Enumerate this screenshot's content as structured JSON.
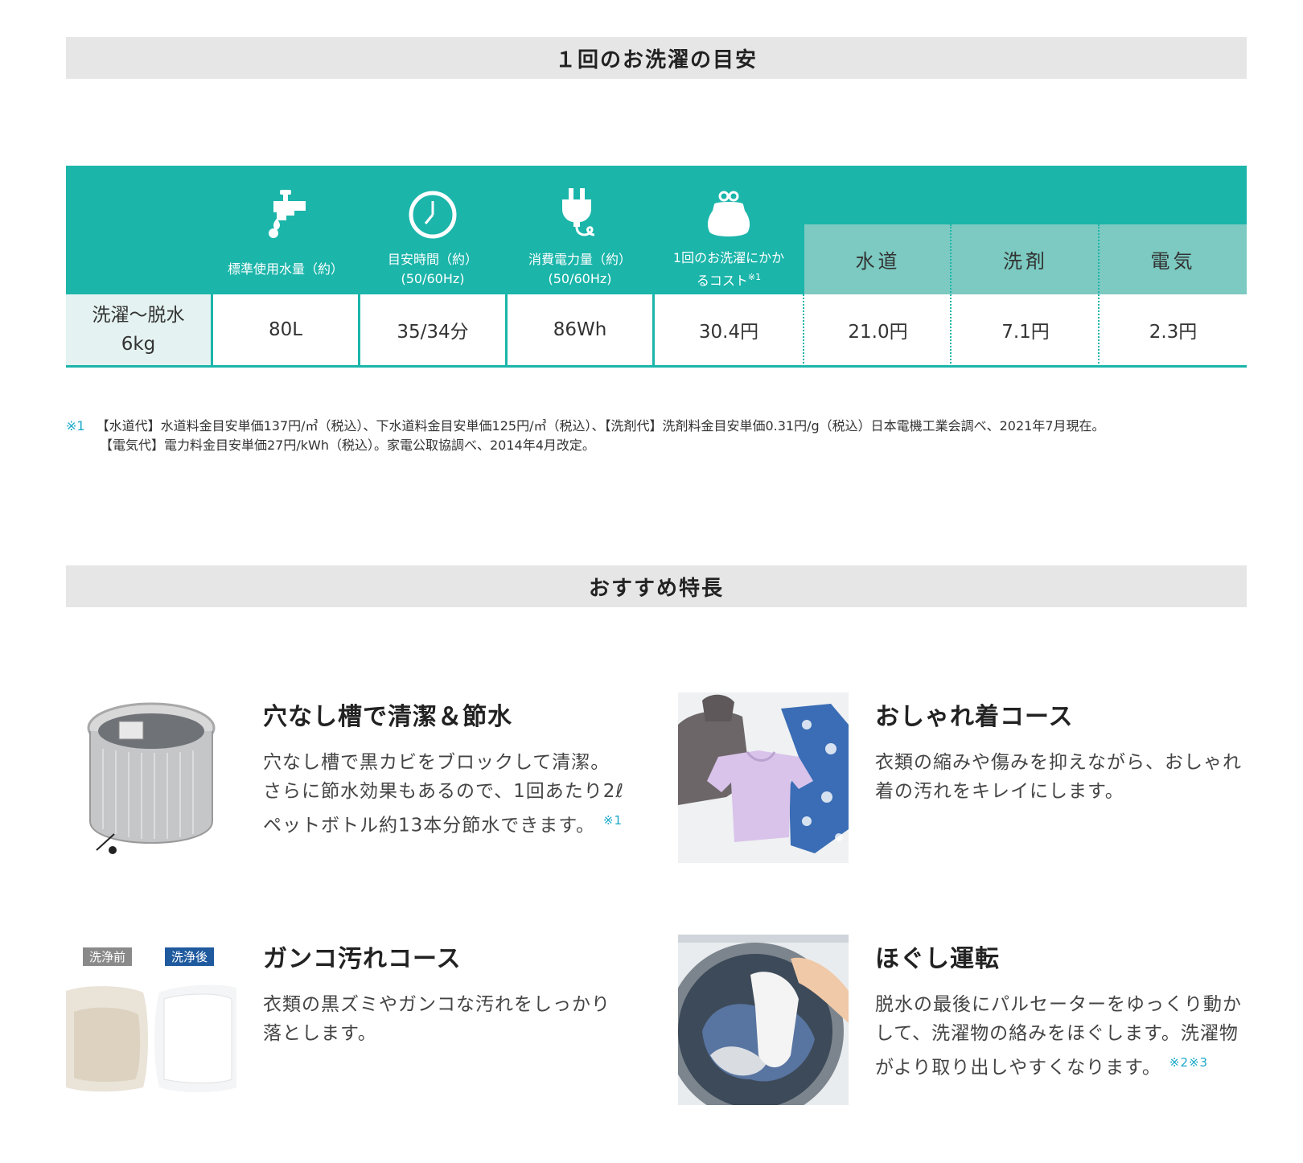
{
  "sections": {
    "guide_title": "１回のお洗濯の目安",
    "features_title": "おすすめ特長"
  },
  "table": {
    "headers": {
      "water": "標準使用水量（約）",
      "time_line1": "目安時間（約）",
      "time_line2": "(50/60Hz)",
      "power_line1": "消費電力量（約）",
      "power_line2": "(50/60Hz)",
      "cost_line1": "1回のお洗濯にかか",
      "cost_line2": "るコスト",
      "cost_note": "※1",
      "sub_water": "水道",
      "sub_detergent": "洗剤",
      "sub_electric": "電気"
    },
    "row_label_line1": "洗濯〜脱水",
    "row_label_line2": "6kg",
    "values": {
      "water": "80L",
      "time": "35/34分",
      "power": "86Wh",
      "cost": "30.4円",
      "water_cost": "21.0円",
      "detergent_cost": "7.1円",
      "electric_cost": "2.3円"
    }
  },
  "footnote": {
    "mark": "※1",
    "line1": "【水道代】水道料金目安単価137円/㎥（税込）、下水道料金目安単価125円/㎥（税込）、【洗剤代】洗剤料金目安単価0.31円/g（税込）日本電機工業会調べ、2021年7月現在。",
    "line2": "【電気代】電力料金目安単価27円/kWh（税込）。家電公取協調べ、2014年4月改定。"
  },
  "features": [
    {
      "title": "穴なし槽で清潔＆節水",
      "body": "穴なし槽で黒カビをブロックして清潔。さらに節水効果もあるので、1回あたり2ℓペットボトル約13本分節水できます。",
      "ref": "※1"
    },
    {
      "title": "おしゃれ着コース",
      "body": "衣類の縮みや傷みを抑えながら、おしゃれ着の汚れをキレイにします。",
      "ref": ""
    },
    {
      "title": "ガンコ汚れコース",
      "body": "衣類の黒ズミやガンコな汚れをしっかり落とします。",
      "ref": "",
      "tag_before": "洗浄前",
      "tag_after": "洗浄後"
    },
    {
      "title": "ほぐし運転",
      "body": "脱水の最後にパルセーターをゆっくり動かして、洗濯物の絡みをほぐします。洗濯物がより取り出しやすくなります。",
      "ref": "※2※3"
    }
  ],
  "colors": {
    "accent": "#1bb5aa",
    "sub_header": "#7ccac1",
    "row_header": "#e4f3f1",
    "footnote_mark": "#1ba8c9",
    "section_bar": "#e6e6e6"
  },
  "icons": [
    "faucet-icon",
    "clock-icon",
    "plug-icon",
    "coin-purse-icon"
  ]
}
